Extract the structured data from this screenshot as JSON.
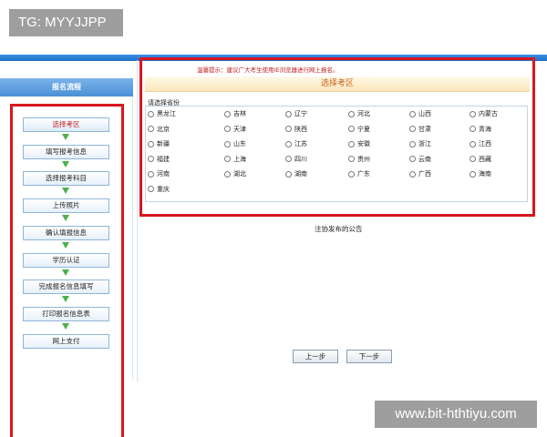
{
  "watermarks": {
    "top_left": "TG: MYYJJPP",
    "bottom_right": "www.bit-hthtiyu.com"
  },
  "sidebar": {
    "title": "报名流程",
    "steps": [
      "选择考区",
      "填写报考信息",
      "选择报考科目",
      "上传照片",
      "确认填报信息",
      "学历认证",
      "完成报名信息填写",
      "打印报名信息表",
      "网上支付"
    ],
    "active_step": 0
  },
  "main": {
    "notice": "温馨提示：建议广大考生使用IE浏览器进行网上报名。",
    "title": "选择考区",
    "group_label": "请选择省份",
    "provinces": [
      "黑龙江",
      "吉林",
      "辽宁",
      "河北",
      "山西",
      "内蒙古",
      "北京",
      "天津",
      "陕西",
      "宁夏",
      "甘肃",
      "青海",
      "新疆",
      "山东",
      "江苏",
      "安徽",
      "浙江",
      "江西",
      "福建",
      "上海",
      "四川",
      "贵州",
      "云南",
      "西藏",
      "河南",
      "湖北",
      "湖南",
      "广东",
      "广西",
      "海南",
      "重庆"
    ],
    "announcement": "注协发布的公告",
    "prev_button": "上一步",
    "next_button": "下一步"
  },
  "colors": {
    "highlight_red": "#d71820",
    "header_blue": "#4a8fd6",
    "title_orange": "#c5611a",
    "arrow_green": "#4db04f"
  }
}
